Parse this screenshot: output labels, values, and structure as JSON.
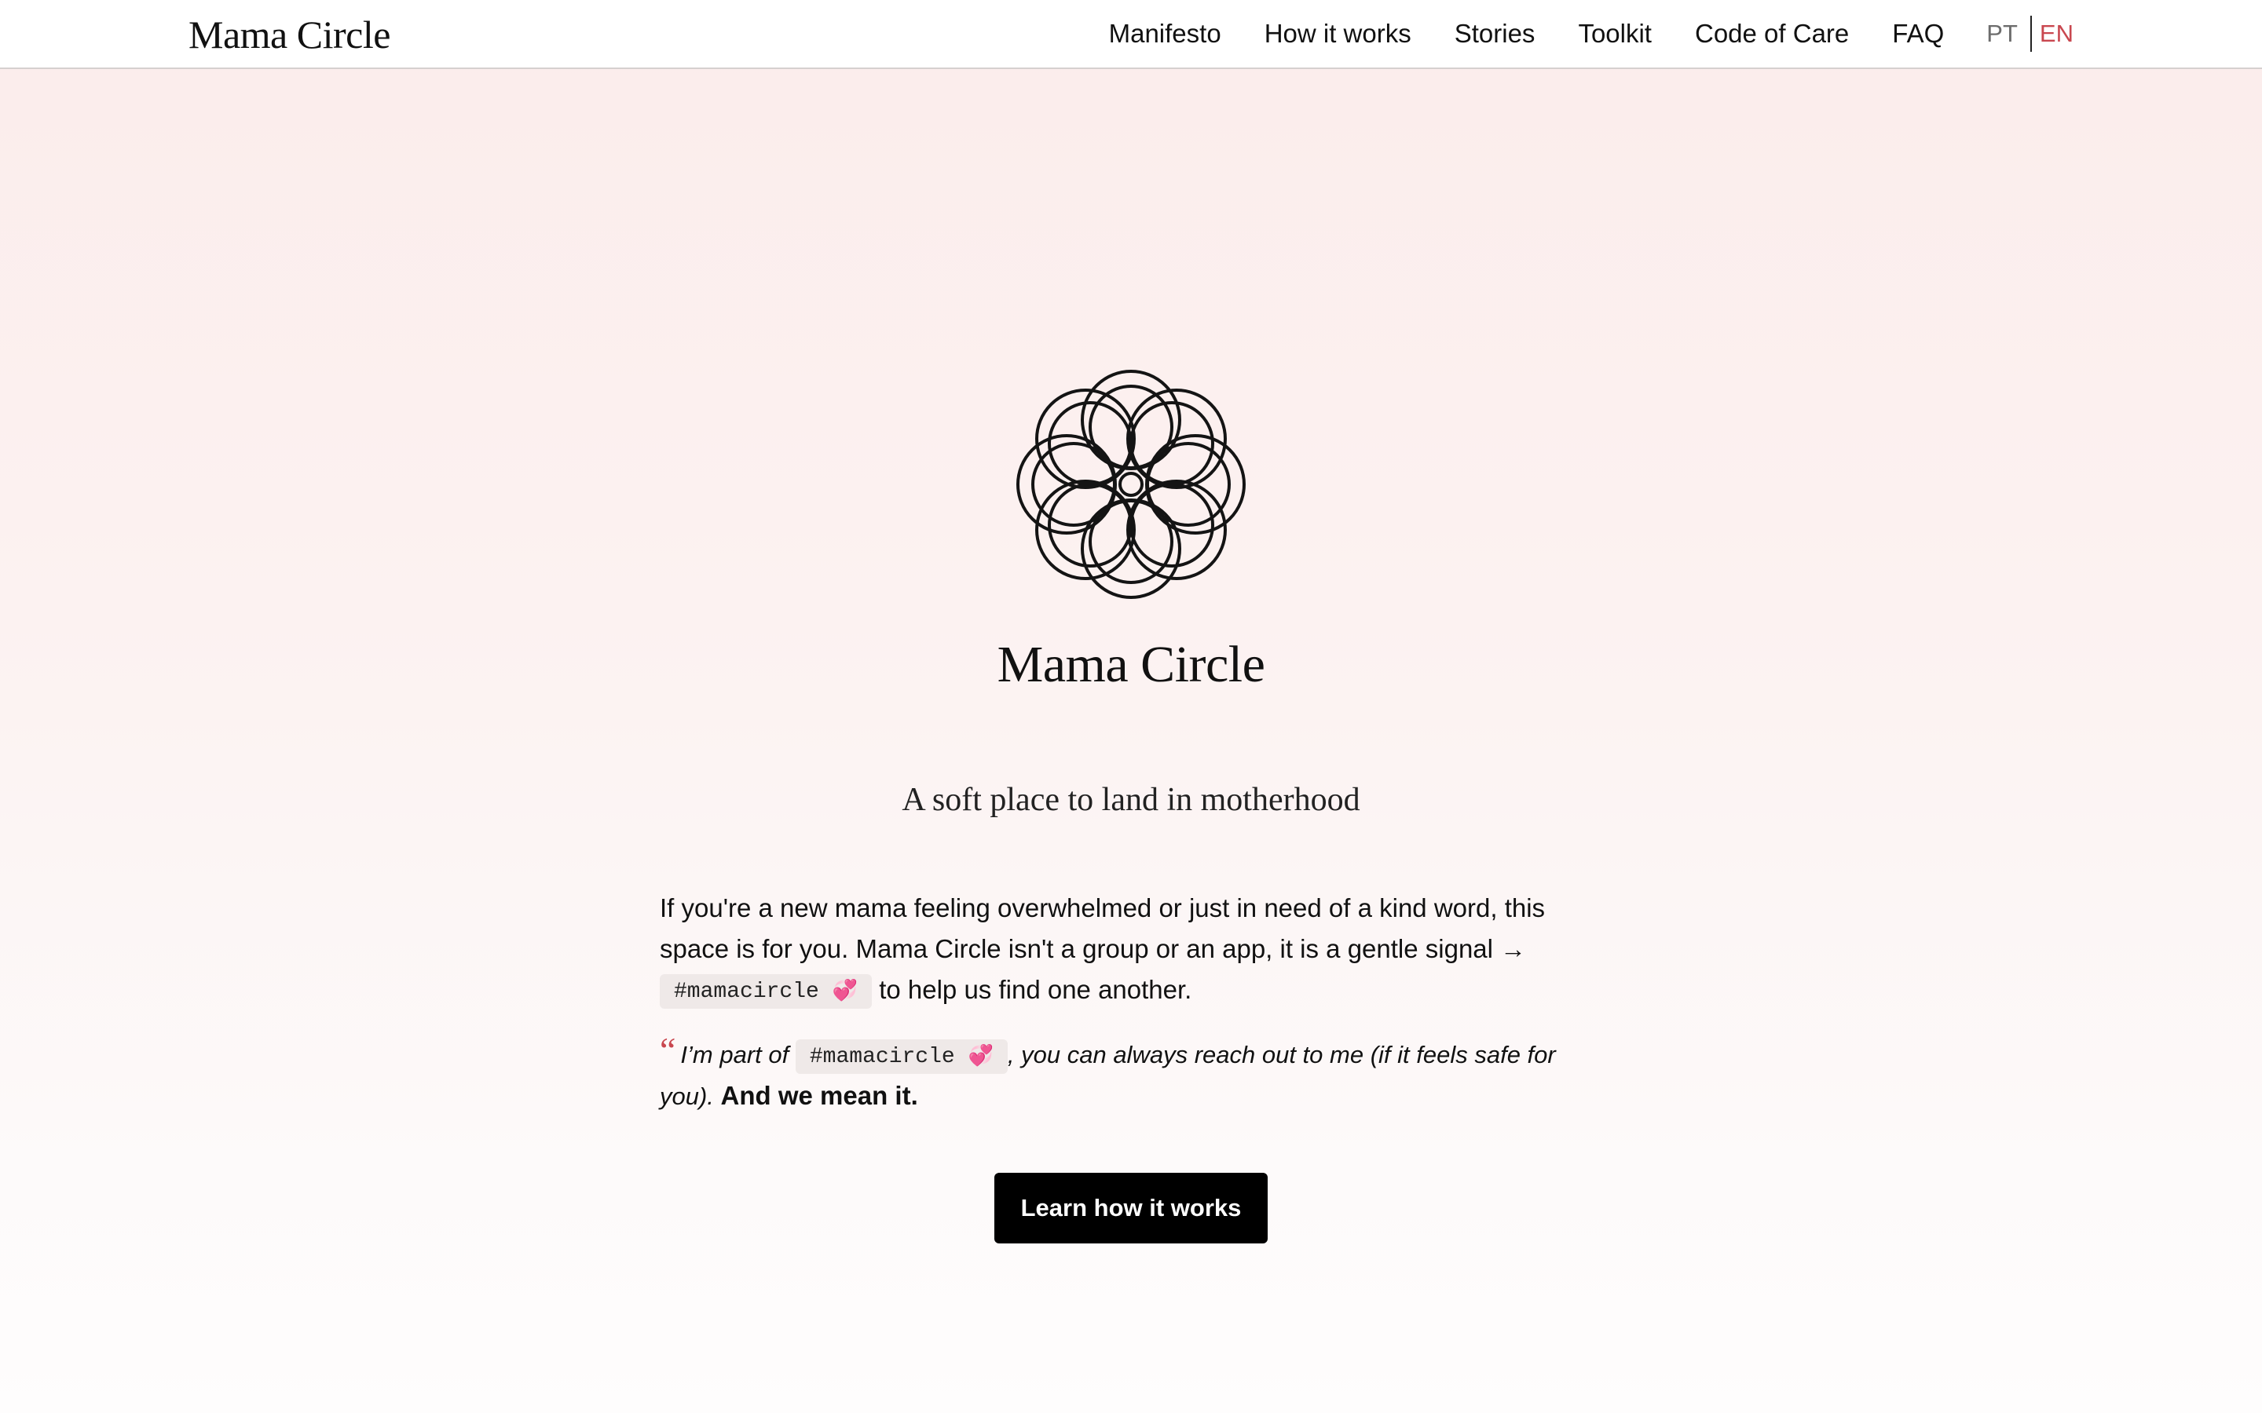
{
  "header": {
    "brand": "Mama Circle",
    "nav": [
      {
        "label": "Manifesto"
      },
      {
        "label": "How it works"
      },
      {
        "label": "Stories"
      },
      {
        "label": "Toolkit"
      },
      {
        "label": "Code of Care"
      },
      {
        "label": "FAQ"
      }
    ],
    "languages": {
      "pt": "PT",
      "en": "EN",
      "active": "EN",
      "active_color": "#c9474f"
    }
  },
  "hero": {
    "logo_icon": "flower-of-life-icon",
    "title": "Mama Circle",
    "tagline": "A soft place to land in motherhood",
    "intro_before": "If you're a new mama feeling overwhelmed or just in need of a kind word, this space is for you. Mama Circle isn't a group or an app, it is a gentle signal →",
    "hashtag": "#mamacircle",
    "heart_emoji": "💞",
    "intro_after": "to help us find one another.",
    "quote_mark": "“",
    "quote_before": "I’m part of",
    "quote_after": ", you can always reach out to me (if it feels safe for you).",
    "quote_emphasis": "And we mean it.",
    "cta_label": "Learn how it works"
  },
  "colors": {
    "accent": "#c9474f",
    "button_bg": "#000000",
    "background_top": "#fbeceb",
    "background_bottom": "#fefdfd"
  }
}
